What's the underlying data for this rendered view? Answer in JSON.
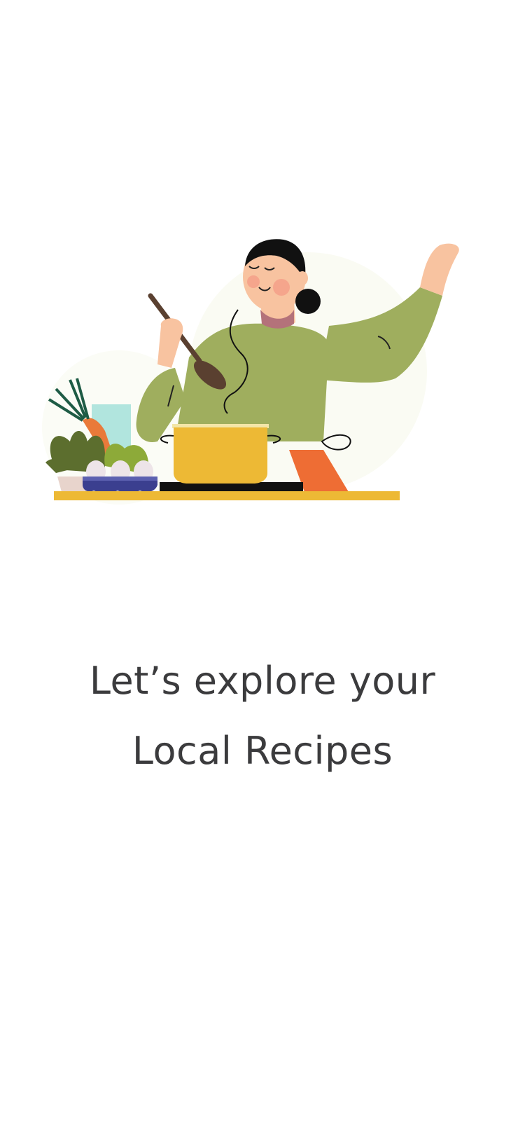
{
  "onboarding": {
    "headline_line1": "Let’s explore your",
    "headline_line2": "Local Recipes"
  },
  "illustration": {
    "subject": "woman-cooking-icon",
    "colors": {
      "sweater": "#9FAE5E",
      "skin": "#F8C3A0",
      "hair": "#111111",
      "pot": "#EDB935",
      "counter": "#EDB935",
      "tablet": "#EE6D34",
      "spoon": "#5A4030",
      "egg_tray": "#3B3F8F",
      "greens": "#5C6E2E",
      "carrot": "#E97A3A",
      "glass": "#A8E2DC",
      "backdrop": "#FAFBF3"
    }
  }
}
